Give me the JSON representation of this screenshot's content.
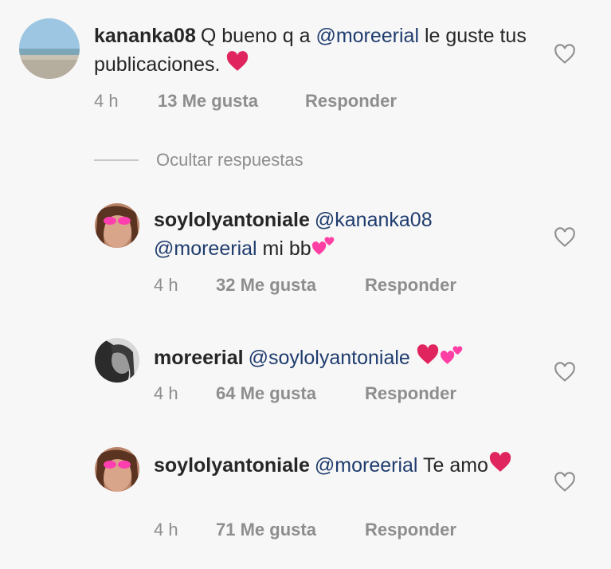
{
  "comments": [
    {
      "username": "kananka08",
      "text_parts": [
        "Q bueno q a ",
        "@moreerial",
        " le guste tus publicaciones. "
      ],
      "time": "4 h",
      "likes": "13 Me gusta",
      "reply": "Responder",
      "avatar": "beach-landscape"
    },
    {
      "username": "soylolyantoniale",
      "text_parts": [
        "@kananka08",
        "@moreerial",
        " mi bb"
      ],
      "time": "4 h",
      "likes": "32 Me gusta",
      "reply": "Responder",
      "avatar": "selfie-pink-sunglasses"
    },
    {
      "username": "moreerial",
      "text_parts": [
        "@soylolyantoniale"
      ],
      "time": "4 h",
      "likes": "64 Me gusta",
      "reply": "Responder",
      "avatar": "bw-portrait"
    },
    {
      "username": "soylolyantoniale",
      "text_parts": [
        "@moreerial",
        " Te amo"
      ],
      "time": "4 h",
      "likes": "71 Me gusta",
      "reply": "Responder",
      "avatar": "selfie-pink-sunglasses"
    }
  ],
  "replies_toggle": "Ocultar respuestas",
  "colors": {
    "mention": "#1f3c6e",
    "meta": "#8e8e8e",
    "heart_emoji": "#e0245e",
    "two_hearts": "#ff3fa4"
  },
  "icons": [
    "heart-outline-icon",
    "red-heart-emoji",
    "two-hearts-emoji"
  ]
}
